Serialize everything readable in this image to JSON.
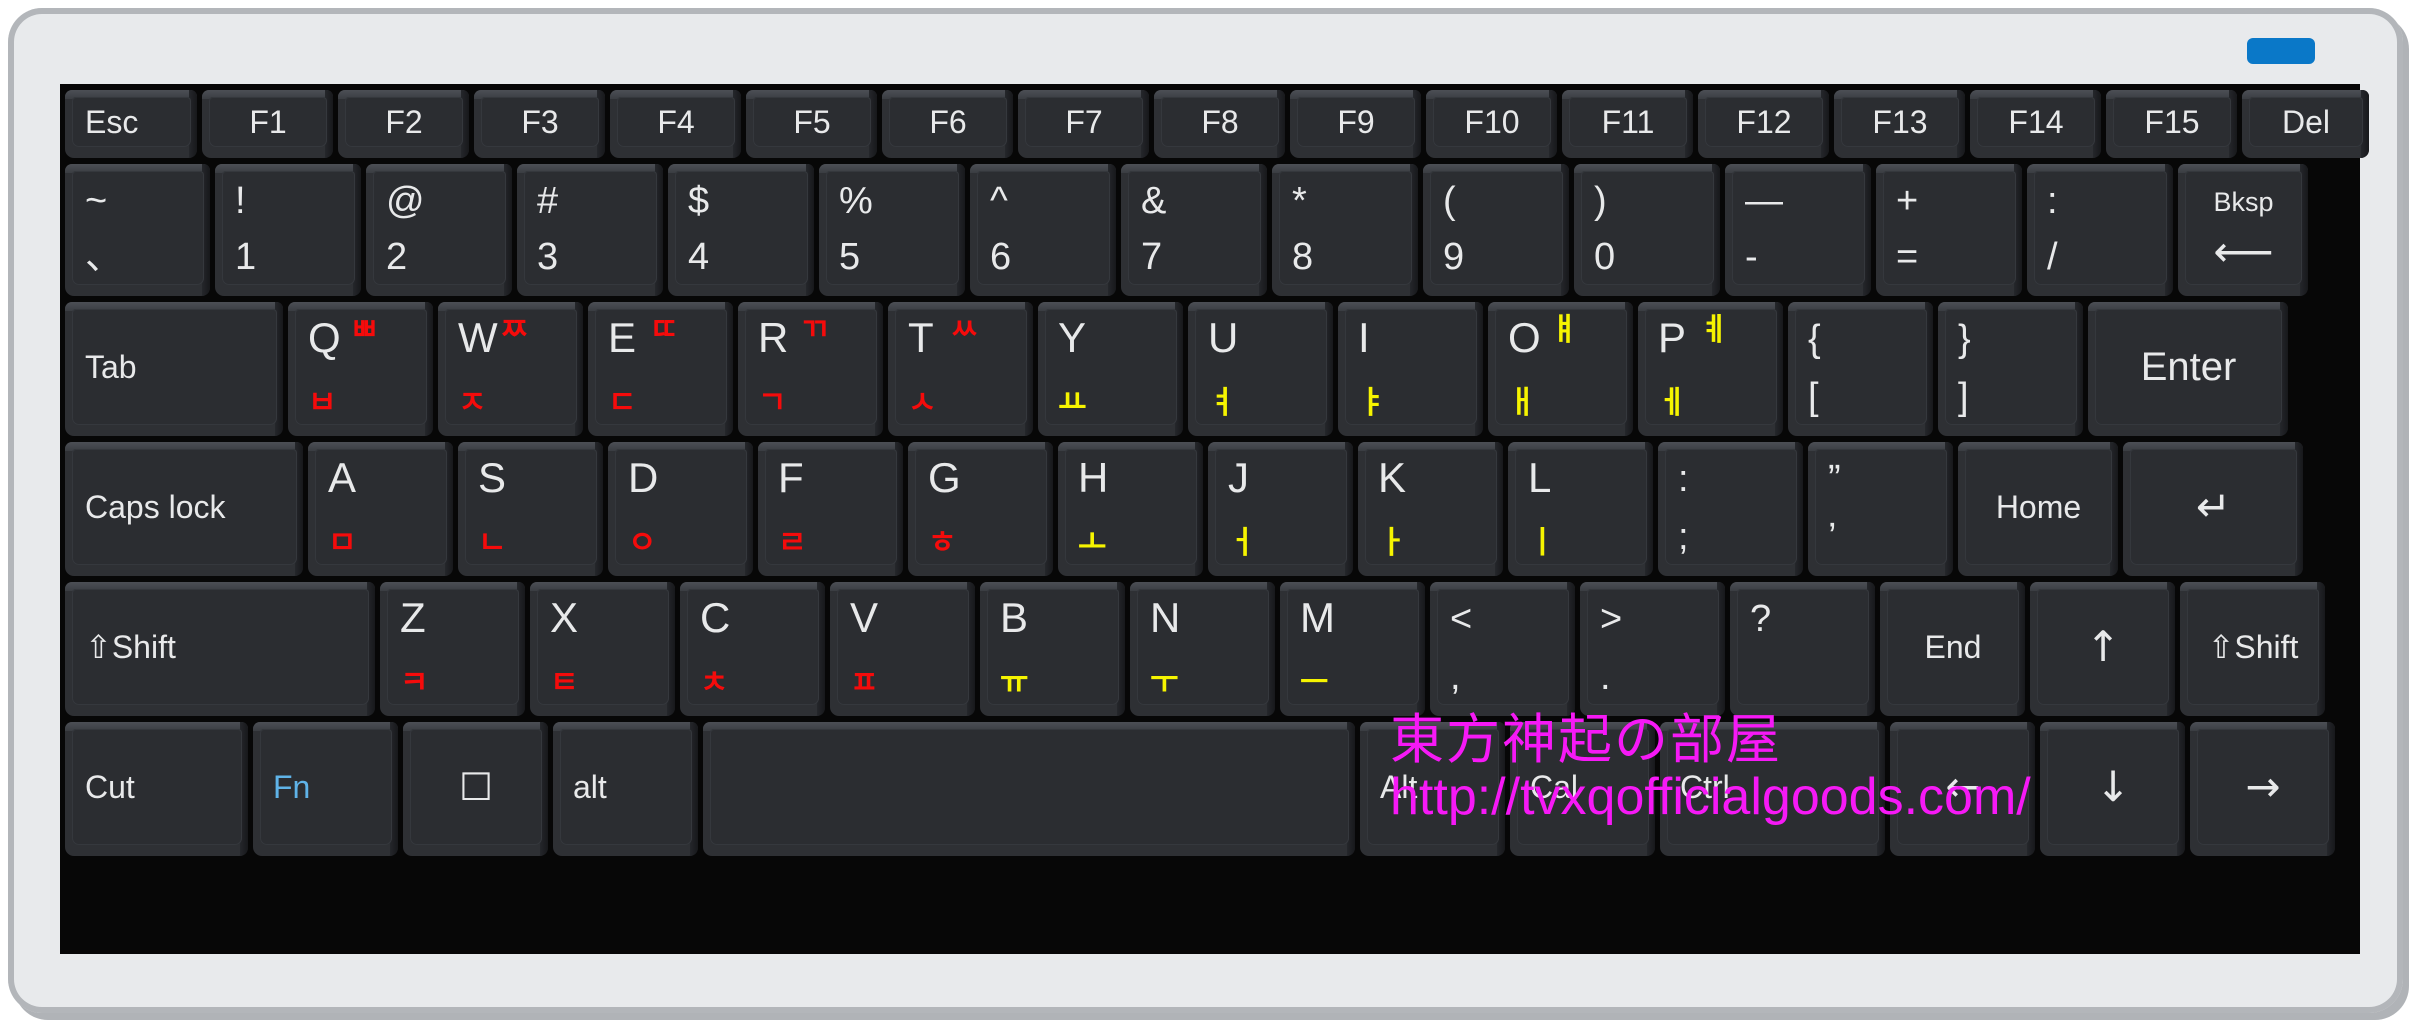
{
  "device": {
    "type": "korean-hangul-keyboard",
    "shell_color": "#e8eaec",
    "deck_color": "#070707",
    "key_color": "#2b2d31",
    "led_color": "#0a78c8",
    "consonant_color": "#f50b0b",
    "vowel_color": "#f6f400",
    "legend_color": "#e8e9ea",
    "fn_color": "#5fb3e8",
    "watermark_color": "#f619f6"
  },
  "watermark": {
    "line1": "東方神起の部屋",
    "line2": "http://tvxqofficialgoods.com/"
  },
  "rows": {
    "function_row": [
      {
        "label": "Esc"
      },
      {
        "label": "F1"
      },
      {
        "label": "F2"
      },
      {
        "label": "F3"
      },
      {
        "label": "F4"
      },
      {
        "label": "F5"
      },
      {
        "label": "F6"
      },
      {
        "label": "F7"
      },
      {
        "label": "F8"
      },
      {
        "label": "F9"
      },
      {
        "label": "F10"
      },
      {
        "label": "F11"
      },
      {
        "label": "F12"
      },
      {
        "label": "F13"
      },
      {
        "label": "F14"
      },
      {
        "label": "F15"
      },
      {
        "label": "Del"
      }
    ],
    "number_row": [
      {
        "top": "~",
        "bottom": "、"
      },
      {
        "top": "!",
        "bottom": "1"
      },
      {
        "top": "@",
        "bottom": "2"
      },
      {
        "top": "#",
        "bottom": "3"
      },
      {
        "top": "$",
        "bottom": "4"
      },
      {
        "top": "%",
        "bottom": "5"
      },
      {
        "top": "^",
        "bottom": "6"
      },
      {
        "top": "&",
        "bottom": "7"
      },
      {
        "top": "*",
        "bottom": "8"
      },
      {
        "top": "(",
        "bottom": "9"
      },
      {
        "top": ")",
        "bottom": "0"
      },
      {
        "top": "—",
        "bottom": "-"
      },
      {
        "top": "+",
        "bottom": "="
      },
      {
        "top": ":",
        "bottom": "/"
      },
      {
        "label": "Bksp",
        "glyph": "⟵"
      }
    ],
    "qwerty_row": [
      {
        "label": "Tab"
      },
      {
        "alpha": "Q",
        "jamo_shift": "ㅃ",
        "jamo": "ㅂ",
        "jamo_kind": "consonant"
      },
      {
        "alpha": "W",
        "jamo_shift": "ㅉ",
        "jamo": "ㅈ",
        "jamo_kind": "consonant"
      },
      {
        "alpha": "E",
        "jamo_shift": "ㄸ",
        "jamo": "ㄷ",
        "jamo_kind": "consonant"
      },
      {
        "alpha": "R",
        "jamo_shift": "ㄲ",
        "jamo": "ㄱ",
        "jamo_kind": "consonant"
      },
      {
        "alpha": "T",
        "jamo_shift": "ㅆ",
        "jamo": "ㅅ",
        "jamo_kind": "consonant"
      },
      {
        "alpha": "Y",
        "jamo_shift": "",
        "jamo": "ㅛ",
        "jamo_kind": "vowel"
      },
      {
        "alpha": "U",
        "jamo_shift": "",
        "jamo": "ㅕ",
        "jamo_kind": "vowel"
      },
      {
        "alpha": "I",
        "jamo_shift": "",
        "jamo": "ㅑ",
        "jamo_kind": "vowel"
      },
      {
        "alpha": "O",
        "jamo_shift": "ㅒ",
        "jamo": "ㅐ",
        "jamo_kind": "vowel"
      },
      {
        "alpha": "P",
        "jamo_shift": "ㅖ",
        "jamo": "ㅔ",
        "jamo_kind": "vowel"
      },
      {
        "top": "{",
        "bottom": "["
      },
      {
        "top": "}",
        "bottom": "]"
      },
      {
        "label": "Enter"
      }
    ],
    "home_row": [
      {
        "label": "Caps lock"
      },
      {
        "alpha": "A",
        "jamo": "ㅁ",
        "jamo_kind": "consonant"
      },
      {
        "alpha": "S",
        "jamo": "ㄴ",
        "jamo_kind": "consonant"
      },
      {
        "alpha": "D",
        "jamo": "ㅇ",
        "jamo_kind": "consonant"
      },
      {
        "alpha": "F",
        "jamo": "ㄹ",
        "jamo_kind": "consonant"
      },
      {
        "alpha": "G",
        "jamo": "ㅎ",
        "jamo_kind": "consonant"
      },
      {
        "alpha": "H",
        "jamo": "ㅗ",
        "jamo_kind": "vowel"
      },
      {
        "alpha": "J",
        "jamo": "ㅓ",
        "jamo_kind": "vowel"
      },
      {
        "alpha": "K",
        "jamo": "ㅏ",
        "jamo_kind": "vowel"
      },
      {
        "alpha": "L",
        "jamo": "ㅣ",
        "jamo_kind": "vowel"
      },
      {
        "top": ":",
        "bottom": ";"
      },
      {
        "top": "”",
        "bottom": "’"
      },
      {
        "label": "Home"
      },
      {
        "label": "",
        "glyph": "↵"
      }
    ],
    "shift_row": [
      {
        "label": "⇧Shift"
      },
      {
        "alpha": "Z",
        "jamo": "ㅋ",
        "jamo_kind": "consonant"
      },
      {
        "alpha": "X",
        "jamo": "ㅌ",
        "jamo_kind": "consonant"
      },
      {
        "alpha": "C",
        "jamo": "ㅊ",
        "jamo_kind": "consonant"
      },
      {
        "alpha": "V",
        "jamo": "ㅍ",
        "jamo_kind": "consonant"
      },
      {
        "alpha": "B",
        "jamo": "ㅠ",
        "jamo_kind": "vowel"
      },
      {
        "alpha": "N",
        "jamo": "ㅜ",
        "jamo_kind": "vowel"
      },
      {
        "alpha": "M",
        "jamo": "ㅡ",
        "jamo_kind": "vowel"
      },
      {
        "top": "<",
        "bottom": ","
      },
      {
        "top": ">",
        "bottom": "."
      },
      {
        "top": "?",
        "bottom": ""
      },
      {
        "label": "End"
      },
      {
        "label": "",
        "glyph": "↑"
      },
      {
        "label": "⇧Shift"
      }
    ],
    "bottom_row": [
      {
        "label": "Cut"
      },
      {
        "label": "Fn",
        "color": "fn"
      },
      {
        "label": "",
        "glyph": "☐"
      },
      {
        "label": "alt"
      },
      {
        "label": ""
      },
      {
        "label": "Alt"
      },
      {
        "label": "Cal"
      },
      {
        "label": "Ctrl"
      },
      {
        "label": "",
        "glyph": "←"
      },
      {
        "label": "",
        "glyph": "↓"
      },
      {
        "label": "",
        "glyph": "→"
      }
    ]
  }
}
